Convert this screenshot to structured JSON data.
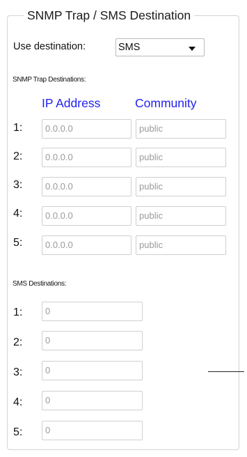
{
  "fieldset_title": "SNMP Trap / SMS Destination",
  "use_destination": {
    "label": "Use destination:",
    "selected": "SMS"
  },
  "snmp": {
    "section_label": "SNMP Trap Destinations:",
    "col_ip": "IP Address",
    "col_community": "Community",
    "rows": [
      {
        "num": "1:",
        "ip": "0.0.0.0",
        "community": "public"
      },
      {
        "num": "2:",
        "ip": "0.0.0.0",
        "community": "public"
      },
      {
        "num": "3:",
        "ip": "0.0.0.0",
        "community": "public"
      },
      {
        "num": "4:",
        "ip": "0.0.0.0",
        "community": "public"
      },
      {
        "num": "5:",
        "ip": "0.0.0.0",
        "community": "public"
      }
    ]
  },
  "sms": {
    "section_label": "SMS Destinations:",
    "rows": [
      {
        "num": "1:",
        "value": "0"
      },
      {
        "num": "2:",
        "value": "0"
      },
      {
        "num": "3:",
        "value": "0"
      },
      {
        "num": "4:",
        "value": "0"
      },
      {
        "num": "5:",
        "value": "0"
      }
    ]
  },
  "colors": {
    "column_header": "#2222ee",
    "placeholder_text": "#9a9a9a",
    "border": "#cfcfcf"
  },
  "icons": {
    "dropdown": "chevron-down-icon"
  }
}
